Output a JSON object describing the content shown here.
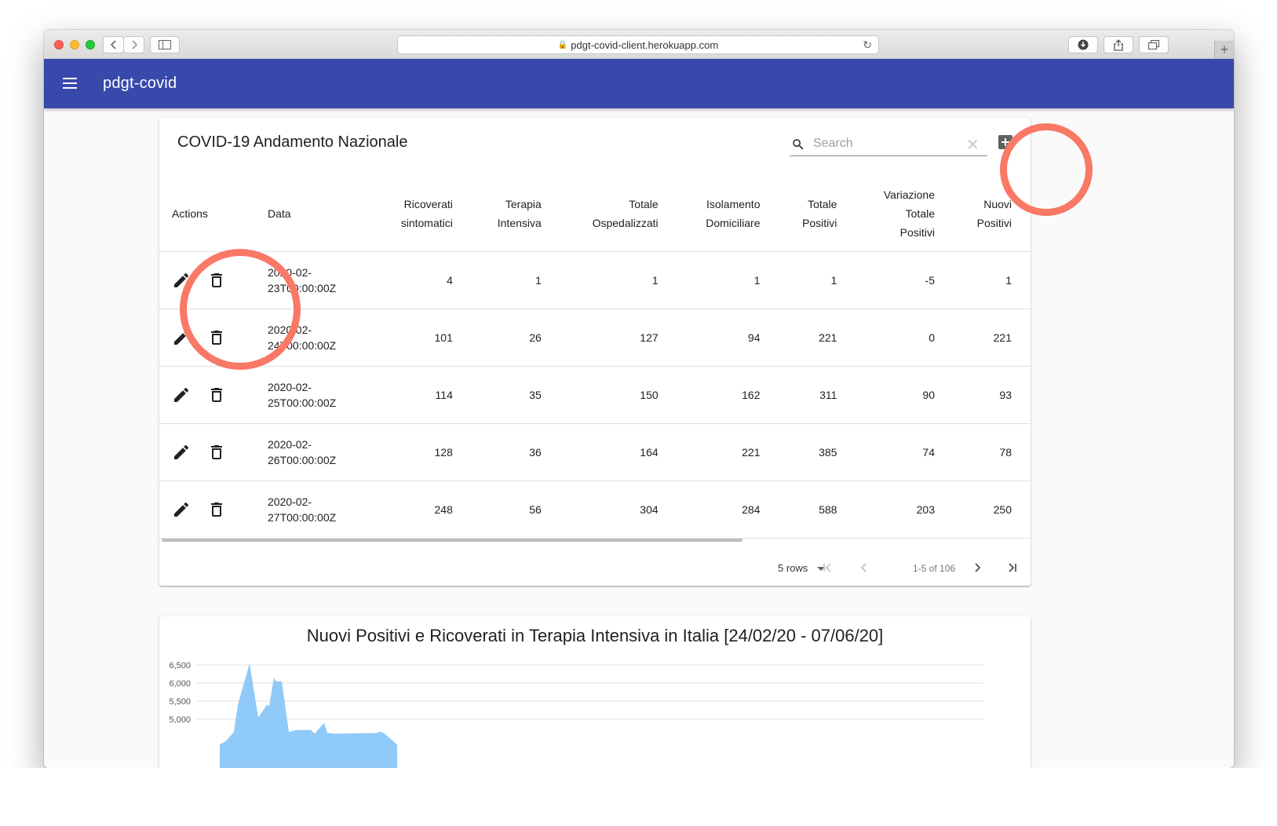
{
  "browser": {
    "url": "pdgt-covid-client.herokuapp.com"
  },
  "appbar": {
    "title": "pdgt-covid"
  },
  "table_card": {
    "title": "COVID-19 Andamento Nazionale",
    "search_placeholder": "Search",
    "columns": [
      {
        "label_lines": [
          "Actions"
        ]
      },
      {
        "label_lines": [
          "Data"
        ]
      },
      {
        "label_lines": [
          "Ricoverati",
          "sintomatici"
        ]
      },
      {
        "label_lines": [
          "Terapia",
          "Intensiva"
        ]
      },
      {
        "label_lines": [
          "Totale",
          "Ospedalizzati"
        ]
      },
      {
        "label_lines": [
          "Isolamento",
          "Domiciliare"
        ]
      },
      {
        "label_lines": [
          "Totale",
          "Positivi"
        ]
      },
      {
        "label_lines": [
          "Variazione",
          "Totale",
          "Positivi"
        ]
      },
      {
        "label_lines": [
          "Nuovi",
          "Positivi"
        ]
      }
    ],
    "rows": [
      {
        "date_line1": "2020-02-",
        "date_line2": "23T00:00:00Z",
        "values": [
          "4",
          "1",
          "1",
          "1",
          "1",
          "-5",
          "1"
        ]
      },
      {
        "date_line1": "2020-02-",
        "date_line2": "24T00:00:00Z",
        "values": [
          "101",
          "26",
          "127",
          "94",
          "221",
          "0",
          "221"
        ]
      },
      {
        "date_line1": "2020-02-",
        "date_line2": "25T00:00:00Z",
        "values": [
          "114",
          "35",
          "150",
          "162",
          "311",
          "90",
          "93"
        ]
      },
      {
        "date_line1": "2020-02-",
        "date_line2": "26T00:00:00Z",
        "values": [
          "128",
          "36",
          "164",
          "221",
          "385",
          "74",
          "78"
        ]
      },
      {
        "date_line1": "2020-02-",
        "date_line2": "27T00:00:00Z",
        "values": [
          "248",
          "56",
          "304",
          "284",
          "588",
          "203",
          "250"
        ]
      }
    ],
    "pagination": {
      "rows_label": "5 rows",
      "range_label": "1-5 of 106"
    }
  },
  "icons": {
    "menu": "menu-icon",
    "search": "search-icon",
    "clear": "close-icon",
    "add": "add-box-icon",
    "edit": "pencil-icon",
    "delete": "trash-icon"
  },
  "colors": {
    "appbar": "#3949ab",
    "annotation_circle": "#fa7866",
    "chart_area": "#90caf9"
  },
  "chart_data": {
    "type": "area",
    "title": "Nuovi Positivi e Ricoverati in Terapia Intensiva in Italia [24/02/20 - 07/06/20]",
    "y_ticks": [
      "6,500",
      "6,000",
      "5,500",
      "5,000"
    ],
    "ylim_visible": [
      4650,
      6650
    ],
    "grid": true,
    "series": [
      {
        "values": [
          [
            0,
            4300
          ],
          [
            8,
            4400
          ],
          [
            18,
            4650
          ],
          [
            23,
            5400
          ],
          [
            38,
            6550
          ],
          [
            49,
            5050
          ],
          [
            60,
            5400
          ],
          [
            63,
            5370
          ],
          [
            69,
            6150
          ],
          [
            72,
            6050
          ],
          [
            79,
            6050
          ],
          [
            88,
            4650
          ],
          [
            98,
            4700
          ],
          [
            116,
            4700
          ],
          [
            121,
            4600
          ],
          [
            133,
            4900
          ],
          [
            137,
            4620
          ],
          [
            147,
            4600
          ],
          [
            200,
            4620
          ],
          [
            205,
            4660
          ],
          [
            210,
            4600
          ],
          [
            226,
            4300
          ]
        ]
      }
    ]
  }
}
